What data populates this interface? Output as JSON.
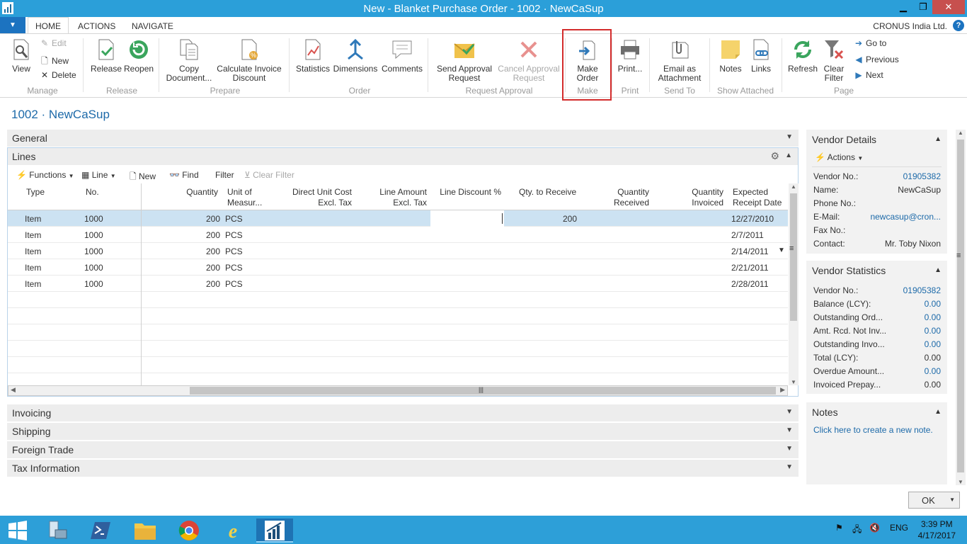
{
  "window": {
    "title": "New - Blanket Purchase Order - 1002 · NewCaSup"
  },
  "tabs": {
    "home": "HOME",
    "actions": "ACTIONS",
    "navigate": "NAVIGATE"
  },
  "company": "CRONUS India Ltd.",
  "ribbon": {
    "view": "View",
    "edit": "Edit",
    "new": "New",
    "delete": "Delete",
    "release": "Release",
    "reopen": "Reopen",
    "copy_document": [
      "Copy",
      "Document..."
    ],
    "calculate_invoice_discount": [
      "Calculate Invoice",
      "Discount"
    ],
    "statistics": "Statistics",
    "dimensions": "Dimensions",
    "comments": "Comments",
    "send_approval": [
      "Send Approval",
      "Request"
    ],
    "cancel_approval": [
      "Cancel Approval",
      "Request"
    ],
    "make_order": [
      "Make",
      "Order"
    ],
    "print": "Print...",
    "email_attachment": [
      "Email as",
      "Attachment"
    ],
    "notes": "Notes",
    "links": "Links",
    "refresh": "Refresh",
    "clear_filter": [
      "Clear",
      "Filter"
    ],
    "go_to": "Go to",
    "previous": "Previous",
    "next": "Next",
    "groups": {
      "manage": "Manage",
      "release": "Release",
      "prepare": "Prepare",
      "order": "Order",
      "request_approval": "Request Approval",
      "make": "Make",
      "print": "Print",
      "send_to": "Send To",
      "show_attached": "Show Attached",
      "page": "Page"
    }
  },
  "page_title": "1002 · NewCaSup",
  "fasttabs": {
    "general": "General",
    "lines": "Lines",
    "invoicing": "Invoicing",
    "shipping": "Shipping",
    "foreign_trade": "Foreign Trade",
    "tax_information": "Tax Information"
  },
  "lines_toolbar": {
    "functions": "Functions",
    "line": "Line",
    "new": "New",
    "find": "Find",
    "filter": "Filter",
    "clear_filter": "Clear Filter"
  },
  "grid": {
    "headers": {
      "type": "Type",
      "no": "No.",
      "quantity": "Quantity",
      "unit": [
        "Unit of",
        "Measur..."
      ],
      "direct_unit_cost": [
        "Direct Unit Cost",
        "Excl. Tax"
      ],
      "line_amount": [
        "Line Amount",
        "Excl. Tax"
      ],
      "line_discount": "Line Discount %",
      "qty_to_receive": "Qty. to Receive",
      "qty_received": [
        "Quantity",
        "Received"
      ],
      "qty_invoiced": [
        "Quantity",
        "Invoiced"
      ],
      "expected_receipt": [
        "Expected",
        "Receipt Date"
      ]
    },
    "rows": [
      {
        "type": "Item",
        "no": "1000",
        "quantity": "200",
        "unit": "PCS",
        "qty_to_receive": "200",
        "date": "12/27/2010"
      },
      {
        "type": "Item",
        "no": "1000",
        "quantity": "200",
        "unit": "PCS",
        "qty_to_receive": "",
        "date": "2/7/2011"
      },
      {
        "type": "Item",
        "no": "1000",
        "quantity": "200",
        "unit": "PCS",
        "qty_to_receive": "",
        "date": "2/14/2011"
      },
      {
        "type": "Item",
        "no": "1000",
        "quantity": "200",
        "unit": "PCS",
        "qty_to_receive": "",
        "date": "2/21/2011"
      },
      {
        "type": "Item",
        "no": "1000",
        "quantity": "200",
        "unit": "PCS",
        "qty_to_receive": "",
        "date": "2/28/2011"
      }
    ]
  },
  "vendor_details": {
    "title": "Vendor Details",
    "actions": "Actions",
    "fields": [
      {
        "label": "Vendor No.:",
        "value": "01905382",
        "link": true
      },
      {
        "label": "Name:",
        "value": "NewCaSup",
        "link": false
      },
      {
        "label": "Phone No.:",
        "value": "",
        "link": false
      },
      {
        "label": "E-Mail:",
        "value": "newcasup@cron...",
        "link": true
      },
      {
        "label": "Fax No.:",
        "value": "",
        "link": false
      },
      {
        "label": "Contact:",
        "value": "Mr. Toby Nixon",
        "link": false
      }
    ]
  },
  "vendor_statistics": {
    "title": "Vendor Statistics",
    "fields": [
      {
        "label": "Vendor No.:",
        "value": "01905382",
        "link": true
      },
      {
        "label": "Balance (LCY):",
        "value": "0.00",
        "link": true
      },
      {
        "label": "Outstanding Ord...",
        "value": "0.00",
        "link": true
      },
      {
        "label": "Amt. Rcd. Not Inv...",
        "value": "0.00",
        "link": true
      },
      {
        "label": "Outstanding Invo...",
        "value": "0.00",
        "link": true
      },
      {
        "label": "Total (LCY):",
        "value": "0.00",
        "link": false
      },
      {
        "label": "Overdue Amount...",
        "value": "0.00",
        "link": true
      },
      {
        "label": "Invoiced Prepay...",
        "value": "0.00",
        "link": false
      }
    ]
  },
  "notes_box": {
    "title": "Notes",
    "link": "Click here to create a new note."
  },
  "ok_button": "OK",
  "taskbar": {
    "lang": "ENG",
    "time": "3:39 PM",
    "date": "4/17/2017"
  },
  "colors": {
    "accent": "#2b9fd9",
    "link": "#1d6aa9",
    "highlight_box": "#d32c2c",
    "selected_row": "#cce2f2"
  }
}
